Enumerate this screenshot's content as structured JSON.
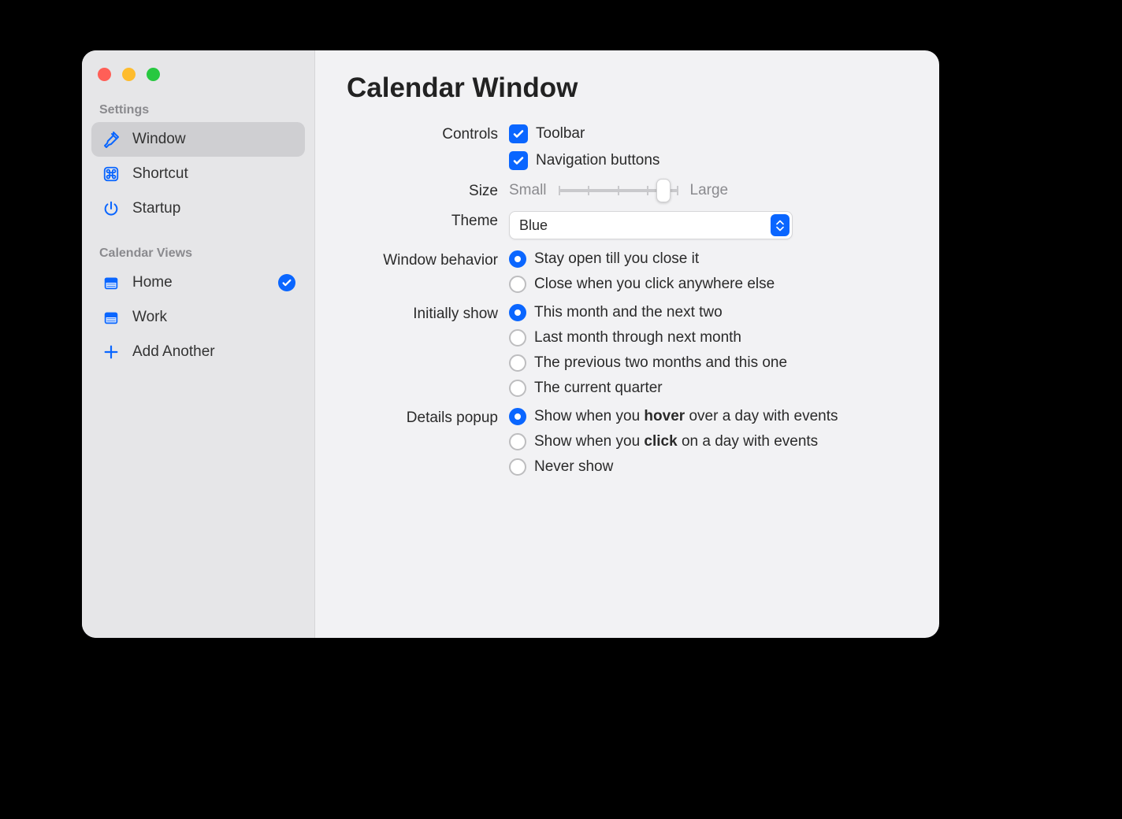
{
  "sidebar": {
    "section_settings": "Settings",
    "section_views": "Calendar Views",
    "items_settings": [
      {
        "label": "Window",
        "icon": "paintbrush-icon",
        "selected": true
      },
      {
        "label": "Shortcut",
        "icon": "command-icon",
        "selected": false
      },
      {
        "label": "Startup",
        "icon": "power-icon",
        "selected": false
      }
    ],
    "items_views": [
      {
        "label": "Home",
        "icon": "calendar-icon",
        "checked": true
      },
      {
        "label": "Work",
        "icon": "calendar-icon",
        "checked": false
      }
    ],
    "add_another": "Add Another"
  },
  "main": {
    "title": "Calendar Window",
    "controls": {
      "label": "Controls",
      "toolbar": "Toolbar",
      "nav_buttons": "Navigation buttons",
      "toolbar_checked": true,
      "nav_checked": true
    },
    "size": {
      "label": "Size",
      "small": "Small",
      "large": "Large",
      "ticks": 5,
      "value_index": 4
    },
    "theme": {
      "label": "Theme",
      "value": "Blue"
    },
    "window_behavior": {
      "label": "Window behavior",
      "options": [
        "Stay open till you close it",
        "Close when you click anywhere else"
      ],
      "selected": 0
    },
    "initially_show": {
      "label": "Initially show",
      "options": [
        "This month and the next two",
        "Last month through next month",
        "The previous two months and this one",
        "The current quarter"
      ],
      "selected": 0
    },
    "details_popup": {
      "label": "Details popup",
      "options": [
        {
          "pre": "Show when you ",
          "strong": "hover",
          "post": " over a day with events"
        },
        {
          "pre": "Show when you ",
          "strong": "click",
          "post": " on a day with events"
        },
        {
          "pre": "Never show",
          "strong": "",
          "post": ""
        }
      ],
      "selected": 0
    }
  }
}
